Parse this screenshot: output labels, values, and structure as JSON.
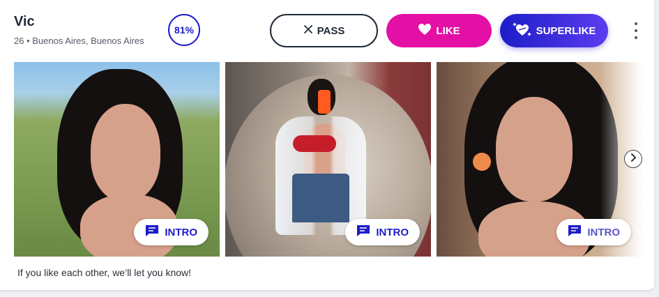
{
  "profile": {
    "name": "Vic",
    "subtitle": "26 • Buenos Aires, Buenos Aires",
    "match": "81%"
  },
  "actions": {
    "pass_label": "PASS",
    "like_label": "LIKE",
    "superlike_label": "SUPERLIKE"
  },
  "photos": [
    {
      "intro_label": "INTRO"
    },
    {
      "intro_label": "INTRO"
    },
    {
      "intro_label": "INTRO"
    }
  ],
  "footer": {
    "note": "If you like each other, we’ll let you know!"
  },
  "icons": {
    "pass": "close-icon",
    "like": "heart-icon",
    "superlike": "superlike-heart-icon",
    "intro": "message-icon",
    "more": "more-vertical-icon",
    "next": "chevron-right-icon"
  },
  "colors": {
    "accent_blue": "#1d1dc8",
    "like_pink": "#e40fa5",
    "superlike_purple": "#5b3df0"
  }
}
